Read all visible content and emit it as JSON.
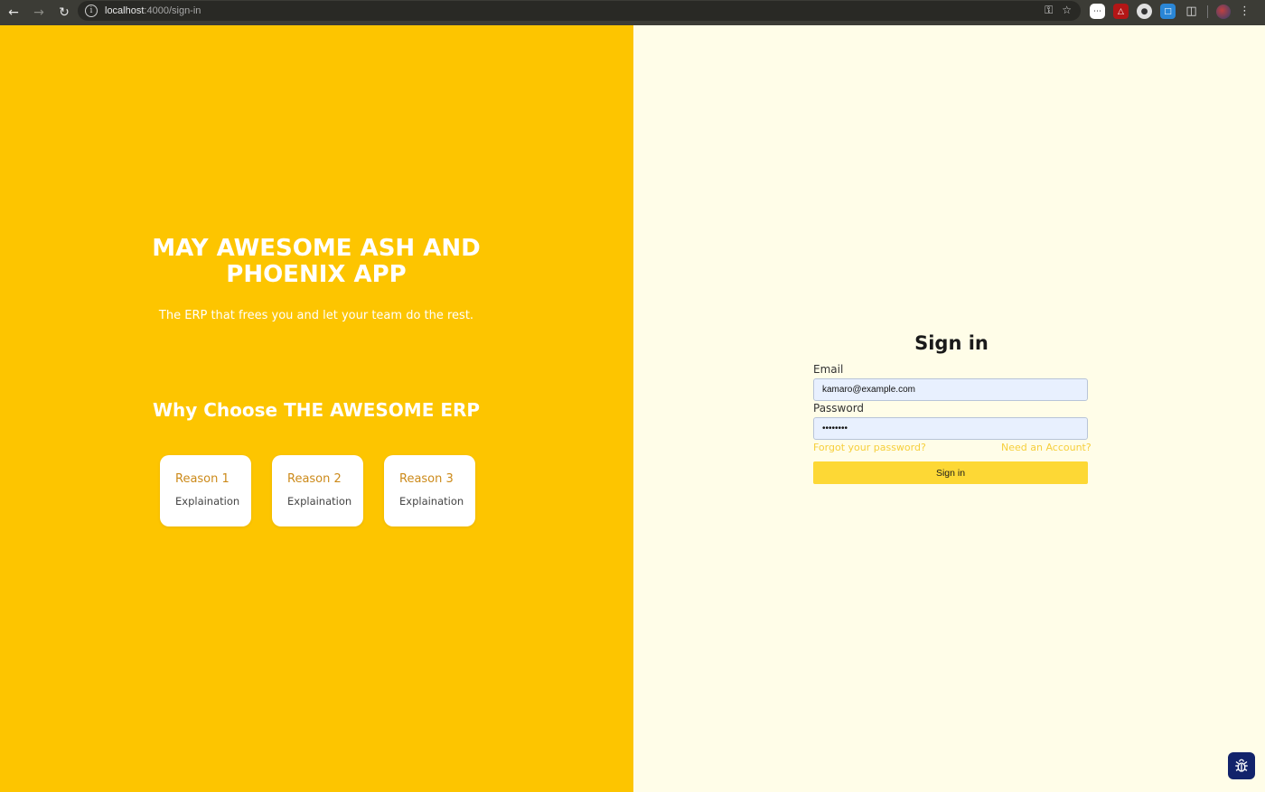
{
  "browser": {
    "url_host": "localhost",
    "url_path": ":4000/sign-in"
  },
  "hero": {
    "title": "MAY AWESOME ASH AND PHOENIX APP",
    "subtitle": "The ERP that frees you and let your team do the rest.",
    "why_title": "Why Choose THE AWESOME ERP",
    "reasons": [
      {
        "title": "Reason 1",
        "text": "Explaination"
      },
      {
        "title": "Reason 2",
        "text": "Explaination"
      },
      {
        "title": "Reason 3",
        "text": "Explaination"
      }
    ]
  },
  "signin": {
    "title": "Sign in",
    "email_label": "Email",
    "email_value": "kamaro@example.com",
    "password_label": "Password",
    "password_value": "••••••••",
    "forgot_link": "Forgot your password?",
    "register_link": "Need an Account?",
    "button_label": "Sign in"
  },
  "colors": {
    "hero_bg": "#fdc500",
    "panel_bg": "#fffde8",
    "button_bg": "#fdd835",
    "link": "#f6cf3c",
    "card_title": "#cc8a1a"
  },
  "icons": {
    "back": "arrow-left-icon",
    "forward": "arrow-right-icon",
    "reload": "reload-icon",
    "site_info": "info-icon",
    "password_key": "key-icon",
    "bookmark": "star-icon",
    "debug": "bug-icon"
  }
}
